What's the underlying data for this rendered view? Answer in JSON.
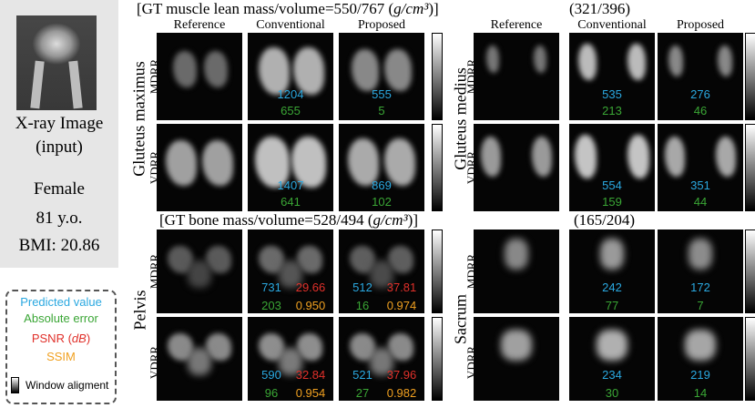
{
  "input": {
    "caption_line1": "X-ray Image",
    "caption_line2": "(input)",
    "sex": "Female",
    "age": "81 y.o.",
    "bmi": "BMI: 20.86"
  },
  "legend": {
    "predicted": "Predicted value",
    "abs_error": "Absolute error",
    "psnr": "PSNR (dB)",
    "ssim": "SSIM",
    "window": "Window aligment"
  },
  "colors": {
    "predicted": "#2aa8e0",
    "abs_error": "#3aa635",
    "psnr": "#e0302a",
    "ssim": "#f0a020"
  },
  "columns": [
    "Reference",
    "Conventional",
    "Proposed"
  ],
  "rows": {
    "mdrr": "MDRR",
    "vdrr": "VDRR"
  },
  "panels": {
    "gluteus_maximus": {
      "title": "[GT muscle lean mass/volume=550/767 (g/cm³)]",
      "group": "Gluteus maximus",
      "mdrr": {
        "conv_pred": "1204",
        "conv_err": "655",
        "prop_pred": "555",
        "prop_err": "5"
      },
      "vdrr": {
        "conv_pred": "1407",
        "conv_err": "641",
        "prop_pred": "869",
        "prop_err": "102"
      }
    },
    "gluteus_medius": {
      "title": "(321/396)",
      "group": "Gluteus medius",
      "mdrr": {
        "conv_pred": "535",
        "conv_err": "213",
        "prop_pred": "276",
        "prop_err": "46"
      },
      "vdrr": {
        "conv_pred": "554",
        "conv_err": "159",
        "prop_pred": "351",
        "prop_err": "44"
      }
    },
    "pelvis": {
      "title": "[GT bone mass/volume=528/494 (g/cm³)]",
      "group": "Pelvis",
      "mdrr": {
        "conv_pred": "731",
        "conv_psnr": "29.66",
        "conv_err": "203",
        "conv_ssim": "0.950",
        "prop_pred": "512",
        "prop_psnr": "37.81",
        "prop_err": "16",
        "prop_ssim": "0.974"
      },
      "vdrr": {
        "conv_pred": "590",
        "conv_psnr": "32.84",
        "conv_err": "96",
        "conv_ssim": "0.954",
        "prop_pred": "521",
        "prop_psnr": "37.96",
        "prop_err": "27",
        "prop_ssim": "0.982"
      }
    },
    "sacrum": {
      "title": "(165/204)",
      "group": "Sacrum",
      "mdrr": {
        "conv_pred": "242",
        "conv_err": "77",
        "prop_pred": "172",
        "prop_err": "7"
      },
      "vdrr": {
        "conv_pred": "234",
        "conv_err": "30",
        "prop_pred": "219",
        "prop_err": "14"
      }
    }
  }
}
